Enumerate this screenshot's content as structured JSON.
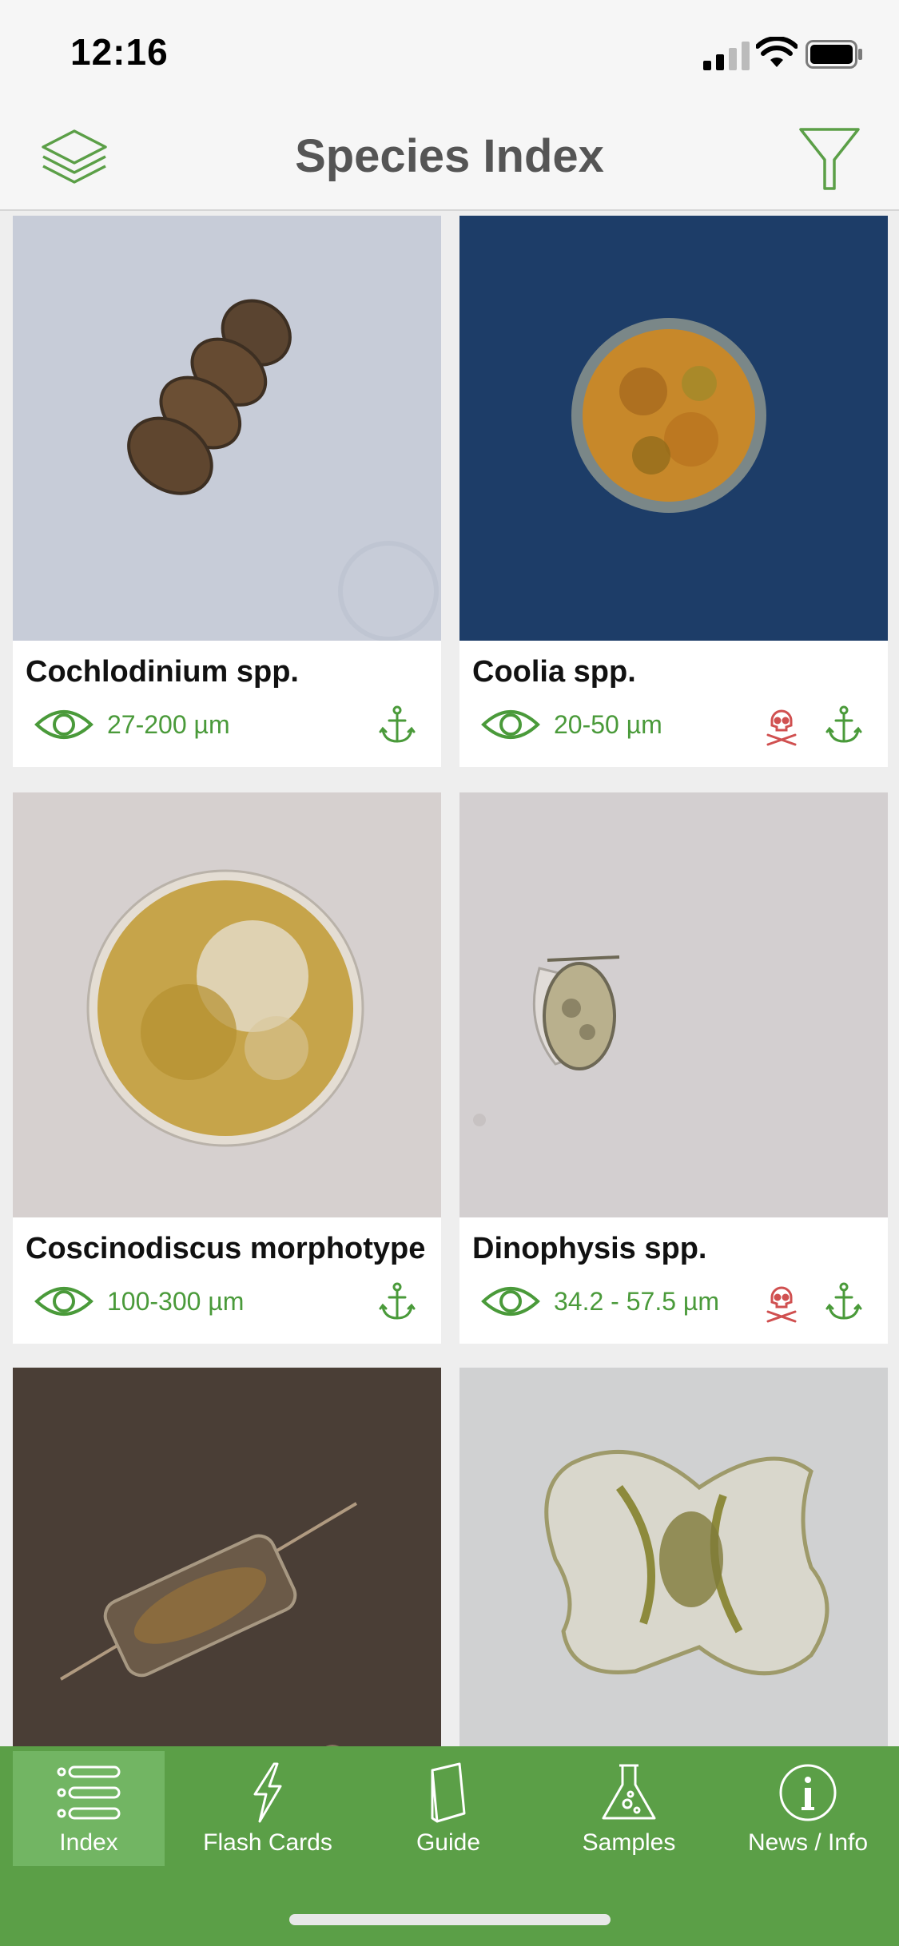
{
  "status_bar": {
    "time": "12:16"
  },
  "nav": {
    "title": "Species Index",
    "left_icon": "layers-icon",
    "right_icon": "filter-funnel-icon"
  },
  "colors": {
    "accent": "#5b9f47",
    "size_text": "#4a9a3a",
    "toxic": "#d05050"
  },
  "species": [
    {
      "name": "Cochlodinium spp.",
      "size": "27-200 µm",
      "toxic": false,
      "anchor": true
    },
    {
      "name": "Coolia spp.",
      "size": "20-50 µm",
      "toxic": true,
      "anchor": true
    },
    {
      "name": "Coscinodiscus morphotype",
      "size": "100-300 µm",
      "toxic": false,
      "anchor": true
    },
    {
      "name": "Dinophysis spp.",
      "size": "34.2 - 57.5 µm",
      "toxic": true,
      "anchor": true
    }
  ],
  "tabs": [
    {
      "label": "Index",
      "icon": "list-icon",
      "active": true
    },
    {
      "label": "Flash Cards",
      "icon": "lightning-icon",
      "active": false
    },
    {
      "label": "Guide",
      "icon": "book-icon",
      "active": false
    },
    {
      "label": "Samples",
      "icon": "flask-icon",
      "active": false
    },
    {
      "label": "News / Info",
      "icon": "info-icon",
      "active": false
    }
  ]
}
